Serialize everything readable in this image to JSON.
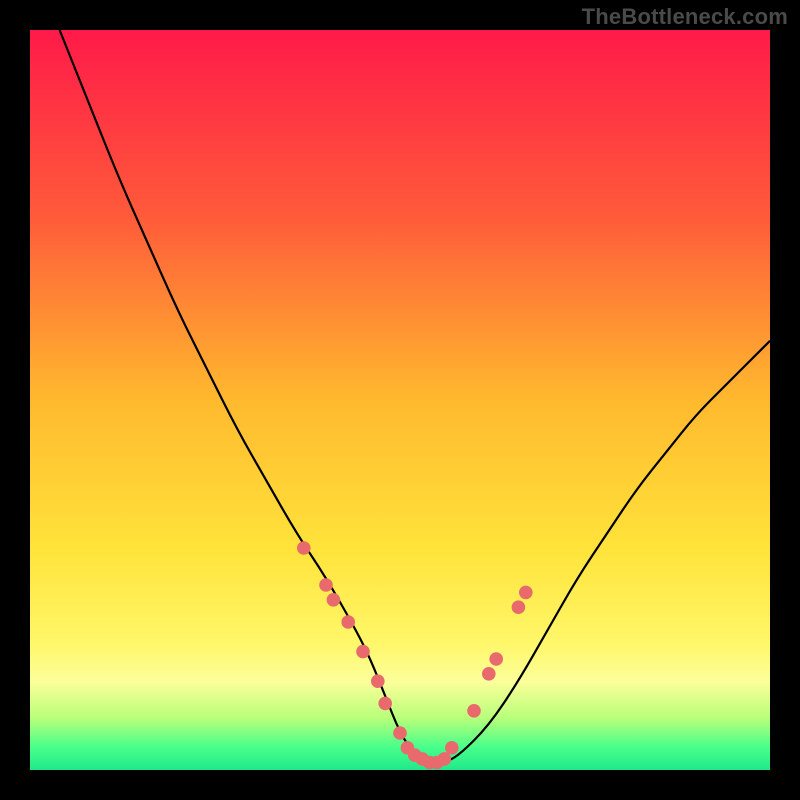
{
  "watermark": "TheBottleneck.com",
  "chart_data": {
    "type": "line",
    "title": "",
    "xlabel": "",
    "ylabel": "",
    "xlim": [
      0,
      100
    ],
    "ylim": [
      0,
      100
    ],
    "gradient_stops": [
      {
        "offset": 0,
        "color": "#ff1a49"
      },
      {
        "offset": 0.25,
        "color": "#ff5a3a"
      },
      {
        "offset": 0.5,
        "color": "#ffb92e"
      },
      {
        "offset": 0.7,
        "color": "#ffe33a"
      },
      {
        "offset": 0.83,
        "color": "#fff76a"
      },
      {
        "offset": 0.88,
        "color": "#fcff9a"
      },
      {
        "offset": 0.93,
        "color": "#b8ff7a"
      },
      {
        "offset": 0.97,
        "color": "#46ff8a"
      },
      {
        "offset": 1.0,
        "color": "#20e98a"
      }
    ],
    "series": [
      {
        "name": "curve",
        "color": "#000000",
        "x": [
          4,
          8,
          12,
          16,
          20,
          24,
          28,
          32,
          36,
          40,
          44,
          46,
          48,
          50,
          52,
          54,
          56,
          58,
          62,
          66,
          70,
          74,
          78,
          82,
          86,
          90,
          94,
          98,
          100
        ],
        "y": [
          100,
          90,
          80,
          71,
          62,
          54,
          46,
          39,
          32,
          26,
          19,
          15,
          10,
          5,
          2,
          1,
          1,
          2,
          6,
          12,
          19,
          26,
          32,
          38,
          43,
          48,
          52,
          56,
          58
        ]
      },
      {
        "name": "highlight-dots",
        "color": "#e86a6d",
        "x": [
          37,
          40,
          41,
          43,
          45,
          47,
          48,
          50,
          51,
          52,
          53,
          54,
          55,
          56,
          57,
          60,
          62,
          63,
          66,
          67
        ],
        "y": [
          30,
          25,
          23,
          20,
          16,
          12,
          9,
          5,
          3,
          2,
          1.5,
          1,
          1,
          1.5,
          3,
          8,
          13,
          15,
          22,
          24
        ]
      }
    ]
  }
}
